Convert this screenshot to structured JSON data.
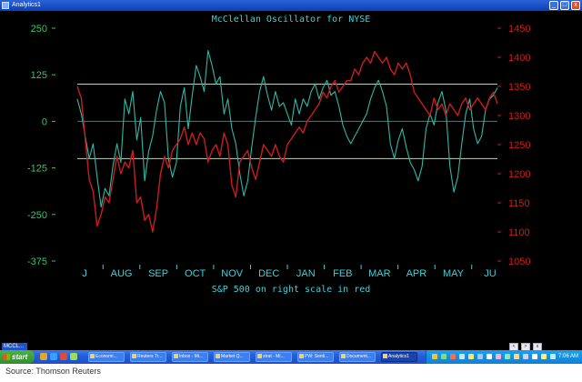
{
  "window": {
    "title": "Analytics1",
    "minimize": "_",
    "maximize": "□",
    "close": "x"
  },
  "chart_data": {
    "type": "line",
    "title": "McClellan Oscillator for NYSE",
    "subtitle": "S&P 500 on right scale in red",
    "x": [
      "J",
      "AUG",
      "SEP",
      "OCT",
      "NOV",
      "DEC",
      "JAN",
      "FEB",
      "MAR",
      "APR",
      "MAY",
      "JU"
    ],
    "left_axis": {
      "ticks": [
        250,
        125,
        0,
        -125,
        -250,
        -375
      ],
      "ylim": [
        -375,
        250
      ],
      "color": "#3cbf72"
    },
    "right_axis": {
      "ticks": [
        1450,
        1400,
        1350,
        1300,
        1250,
        1200,
        1150,
        1100,
        1050
      ],
      "ylim": [
        1050,
        1450
      ],
      "color": "#c81e1e"
    },
    "reference_lines": [
      100,
      0,
      -100
    ],
    "series": [
      {
        "axis": "left",
        "color": "#2fb8a6",
        "values": [
          60,
          20,
          -40,
          -100,
          -60,
          -150,
          -230,
          -180,
          -200,
          -120,
          -60,
          -110,
          60,
          20,
          80,
          -50,
          10,
          -160,
          -80,
          -40,
          30,
          80,
          50,
          -100,
          -150,
          -110,
          40,
          90,
          -20,
          70,
          150,
          120,
          80,
          190,
          150,
          100,
          120,
          20,
          60,
          -20,
          -60,
          -140,
          -200,
          -160,
          -70,
          10,
          80,
          120,
          70,
          30,
          80,
          40,
          50,
          20,
          -10,
          60,
          20,
          60,
          40,
          80,
          100,
          60,
          90,
          110,
          70,
          80,
          40,
          -10,
          -40,
          -60,
          -40,
          -20,
          0,
          20,
          60,
          90,
          110,
          80,
          40,
          -60,
          -100,
          -50,
          -20,
          -70,
          -110,
          -130,
          -160,
          -120,
          -20,
          20,
          -10,
          50,
          80,
          30,
          -120,
          -190,
          -150,
          -60,
          20,
          60,
          -20,
          -60,
          -40,
          30,
          60,
          70,
          90
        ]
      },
      {
        "axis": "right",
        "color": "#c81e1e",
        "values": [
          1350,
          1330,
          1260,
          1190,
          1170,
          1110,
          1130,
          1160,
          1150,
          1190,
          1230,
          1200,
          1220,
          1210,
          1240,
          1150,
          1160,
          1120,
          1130,
          1100,
          1140,
          1200,
          1230,
          1210,
          1240,
          1250,
          1260,
          1280,
          1250,
          1270,
          1250,
          1270,
          1260,
          1220,
          1240,
          1250,
          1230,
          1270,
          1250,
          1180,
          1160,
          1220,
          1230,
          1240,
          1210,
          1190,
          1220,
          1250,
          1240,
          1230,
          1250,
          1230,
          1220,
          1250,
          1260,
          1270,
          1280,
          1270,
          1290,
          1300,
          1310,
          1320,
          1340,
          1330,
          1350,
          1360,
          1340,
          1350,
          1360,
          1360,
          1380,
          1370,
          1390,
          1400,
          1390,
          1410,
          1400,
          1390,
          1400,
          1380,
          1370,
          1390,
          1380,
          1390,
          1370,
          1340,
          1330,
          1320,
          1310,
          1300,
          1330,
          1310,
          1320,
          1300,
          1320,
          1310,
          1300,
          1320,
          1330,
          1310,
          1320,
          1330,
          1320,
          1310,
          1330,
          1340,
          1320
        ]
      }
    ]
  },
  "status": {
    "minimized_window": "MCCL...",
    "min_buttons": [
      "<",
      ">",
      "x"
    ]
  },
  "taskbar": {
    "start_label": "start",
    "tasks": [
      "Economi...",
      "Reuters Tr...",
      "Inbox - Mi...",
      "Market Q...",
      "strat - Mi...",
      "PW: Senti...",
      "Document...",
      "Analytics1"
    ],
    "active_task": 7,
    "clock": "7:06 AM"
  },
  "source": "Source:  Thomson Reuters"
}
